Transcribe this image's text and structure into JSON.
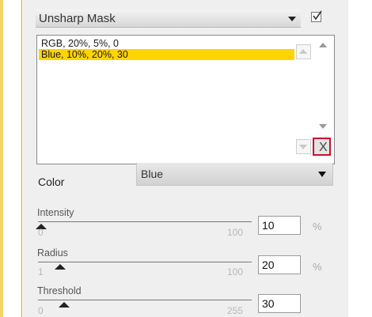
{
  "preset": {
    "label": "Unsharp Mask",
    "enabled": true
  },
  "list": {
    "items": [
      "RGB, 20%, 5%, 0",
      "Blue, 10%, 20%, 30"
    ],
    "selected_index": 1
  },
  "delete_button": {
    "label": "X"
  },
  "color": {
    "label": "Color",
    "value": "Blue"
  },
  "params": {
    "intensity": {
      "label": "Intensity",
      "min": "0",
      "max": "100",
      "value": "10",
      "unit": "%"
    },
    "radius": {
      "label": "Radius",
      "min": "1",
      "max": "100",
      "value": "20",
      "unit": "%"
    },
    "threshold": {
      "label": "Threshold",
      "min": "0",
      "max": "255",
      "value": "30"
    }
  },
  "colors": {
    "selection": "#ffd400",
    "highlight_border": "#c8102e",
    "panel_bg": "#efefef"
  },
  "icons": {
    "enable_toggle": "check-icon",
    "dropdown": "chevron-down-icon",
    "scroll_up": "arrow-up-icon",
    "scroll_down": "arrow-down-icon"
  }
}
